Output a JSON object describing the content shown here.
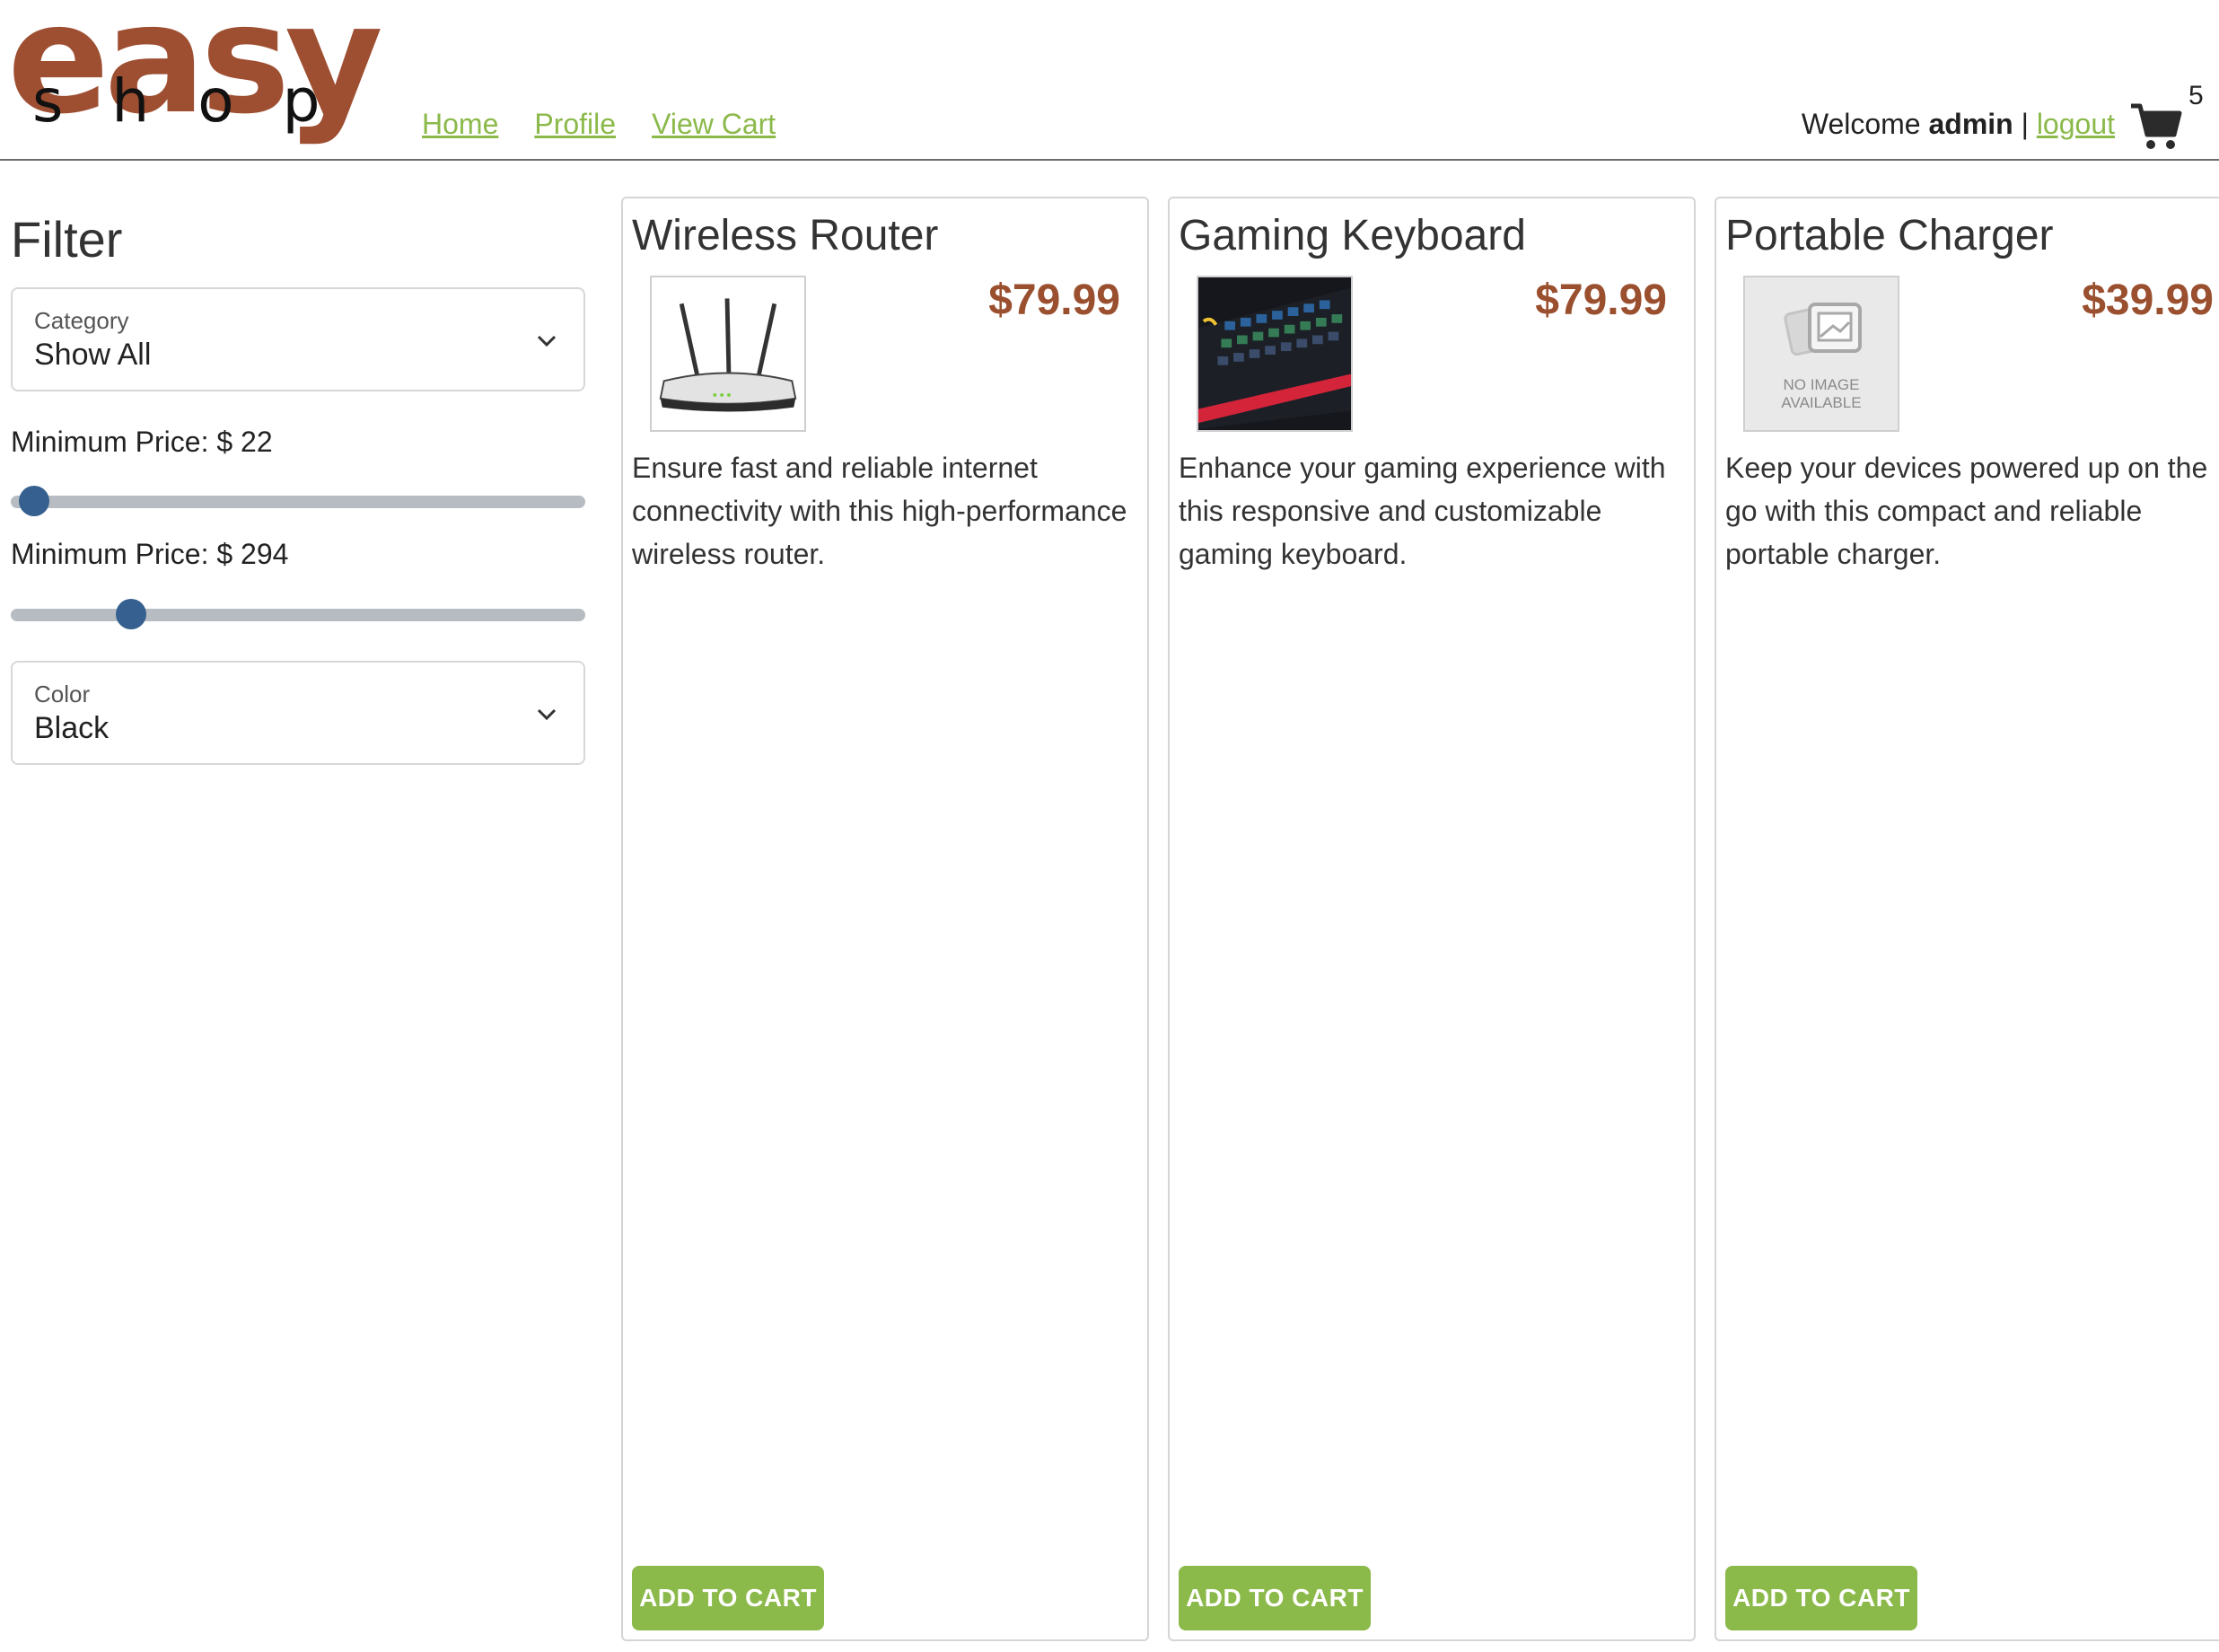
{
  "brand": {
    "top": "easy",
    "bottom": "shop"
  },
  "nav": {
    "items": [
      {
        "label": "Home"
      },
      {
        "label": "Profile"
      },
      {
        "label": "View Cart"
      }
    ]
  },
  "user": {
    "welcome": "Welcome",
    "name": "admin",
    "separator": "|",
    "logout": "logout"
  },
  "cart": {
    "count": "5",
    "icon": "shopping-cart-icon"
  },
  "filter": {
    "title": "Filter",
    "category": {
      "label": "Category",
      "value": "Show All"
    },
    "min_price": {
      "label": "Minimum Price: $ 22",
      "value": 22,
      "level": 0.04
    },
    "max_price": {
      "label": "Minimum Price: $ 294",
      "value": 294,
      "level": 0.21
    },
    "color": {
      "label": "Color",
      "value": "Black"
    }
  },
  "products": [
    {
      "title": "Wireless Router",
      "price": "$79.99",
      "description": "Ensure fast and reliable internet connectivity with this high-performance wireless router.",
      "button": "ADD TO CART",
      "image": "router-image"
    },
    {
      "title": "Gaming Keyboard",
      "price": "$79.99",
      "description": "Enhance your gaming experience with this responsive and customizable gaming keyboard.",
      "button": "ADD TO CART",
      "image": "keyboard-image"
    },
    {
      "title": "Portable Charger",
      "price": "$39.99",
      "description": "Keep your devices powered up on the go with this compact and reliable portable charger.",
      "button": "ADD TO CART",
      "image": "no-image-placeholder",
      "no_image_text": "NO IMAGE AVAILABLE"
    }
  ],
  "colors": {
    "brand": "#9e4f32",
    "link": "#8bb94a",
    "button": "#8bb94a",
    "slider": "#35608f"
  }
}
